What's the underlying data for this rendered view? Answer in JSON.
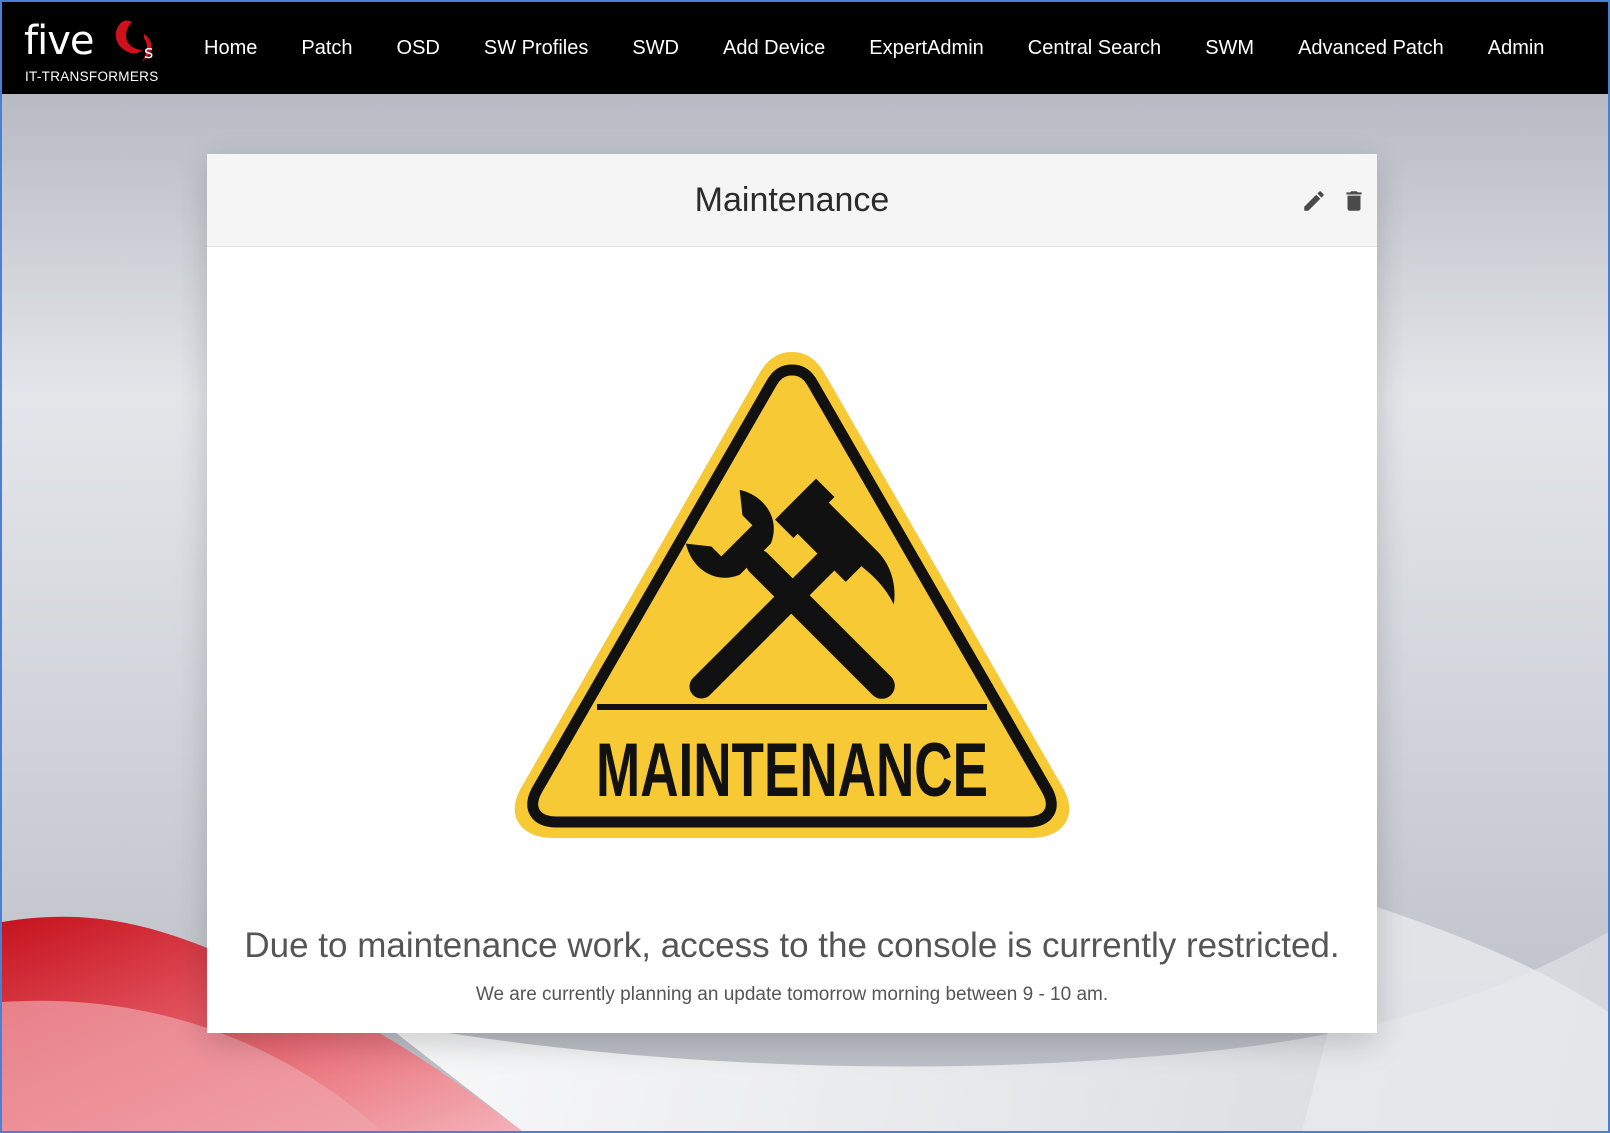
{
  "brand": {
    "word": "five",
    "suffix": "s",
    "tagline": "IT-TRANSFORMERS",
    "accent_color": "#d0101a"
  },
  "nav": {
    "items": [
      {
        "label": "Home"
      },
      {
        "label": "Patch"
      },
      {
        "label": "OSD"
      },
      {
        "label": "SW Profiles"
      },
      {
        "label": "SWD"
      },
      {
        "label": "Add Device"
      },
      {
        "label": "ExpertAdmin"
      },
      {
        "label": "Central Search"
      },
      {
        "label": "SWM"
      },
      {
        "label": "Advanced Patch"
      },
      {
        "label": "Admin"
      }
    ]
  },
  "card": {
    "title": "Maintenance",
    "actions": {
      "edit_icon": "pencil-icon",
      "delete_icon": "trash-icon"
    },
    "sign": {
      "label": "MAINTENANCE",
      "icon": "hammer-wrench-icon",
      "fill_color": "#f7c934",
      "stroke_color": "#111111"
    },
    "message": "Due to maintenance work, access to the console is currently restricted.",
    "submessage": "We are currently planning an update tomorrow morning between 9 - 10 am."
  }
}
